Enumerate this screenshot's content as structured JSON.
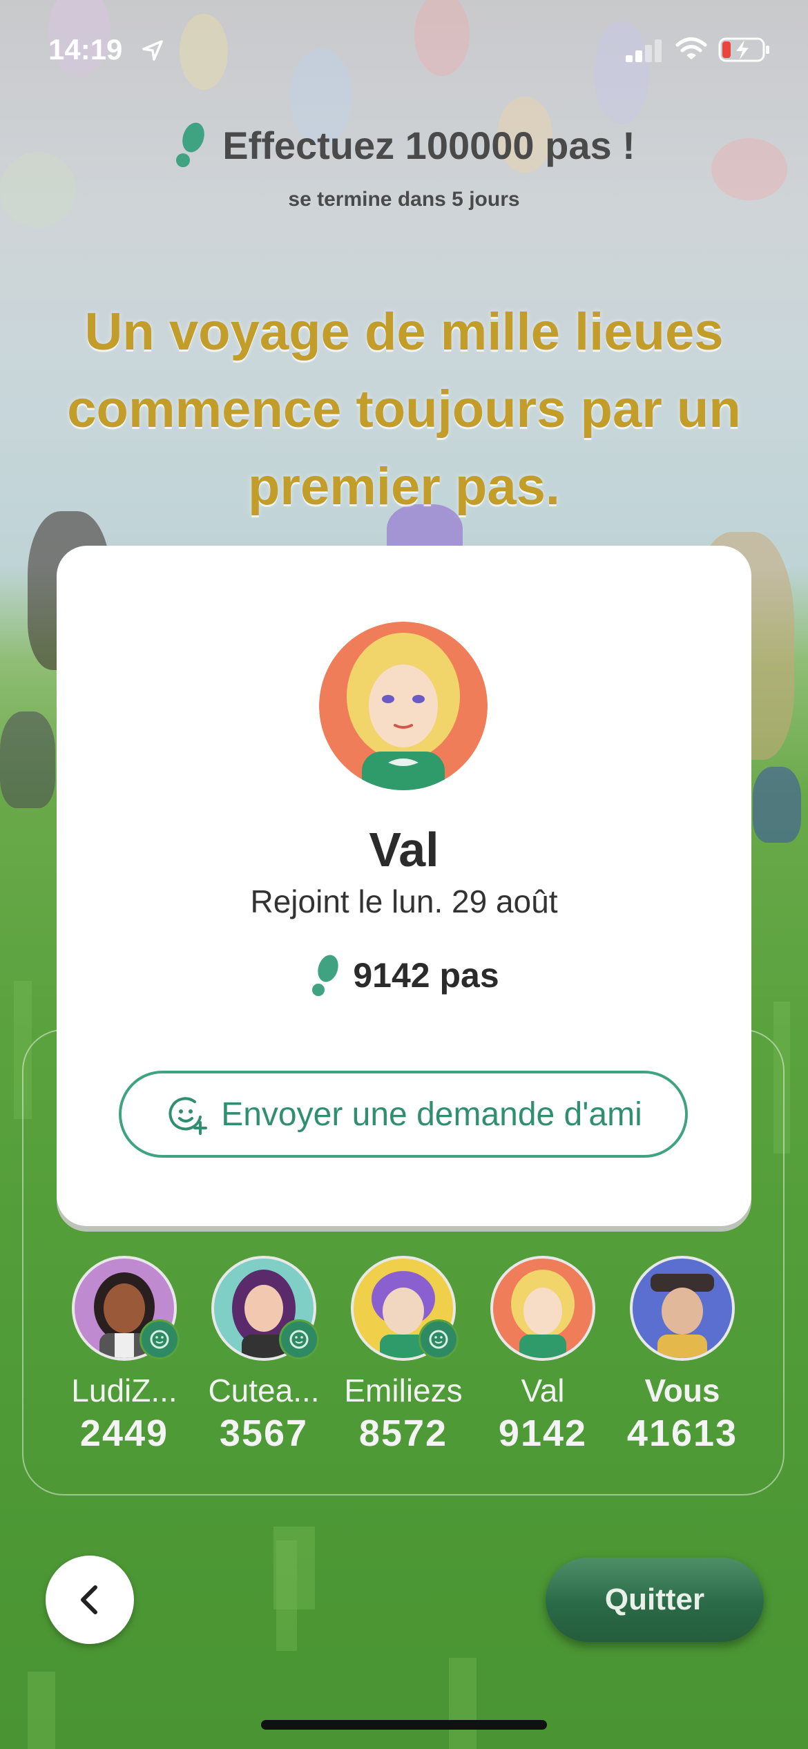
{
  "status_bar": {
    "time": "14:19"
  },
  "challenge": {
    "title": "Effectuez 100000 pas !",
    "subtitle": "se termine dans 5 jours",
    "quote": "Un voyage de mille lieues commence toujours par un premier pas."
  },
  "profile": {
    "name": "Val",
    "joined": "Rejoint le lun. 29 août",
    "steps": "9142 pas",
    "friend_request_label": "Envoyer une demande d'ami"
  },
  "leaderboard": {
    "players": [
      {
        "name": "LudiZ...",
        "steps": "2449",
        "friend_badge": true,
        "avatar_color": "#c08ad0"
      },
      {
        "name": "Cutea...",
        "steps": "3567",
        "friend_badge": true,
        "avatar_color": "#7fcfc6"
      },
      {
        "name": "Emiliezs",
        "steps": "8572",
        "friend_badge": true,
        "avatar_color": "#f0d04a"
      },
      {
        "name": "Val",
        "steps": "9142",
        "friend_badge": false,
        "avatar_color": "#ef7d5a"
      },
      {
        "name": "Vous",
        "steps": "41613",
        "friend_badge": false,
        "avatar_color": "#5a6fcf"
      }
    ]
  },
  "controls": {
    "quit_label": "Quitter"
  },
  "colors": {
    "accent_green": "#3fa382",
    "quote_gold": "#c29d2a"
  }
}
